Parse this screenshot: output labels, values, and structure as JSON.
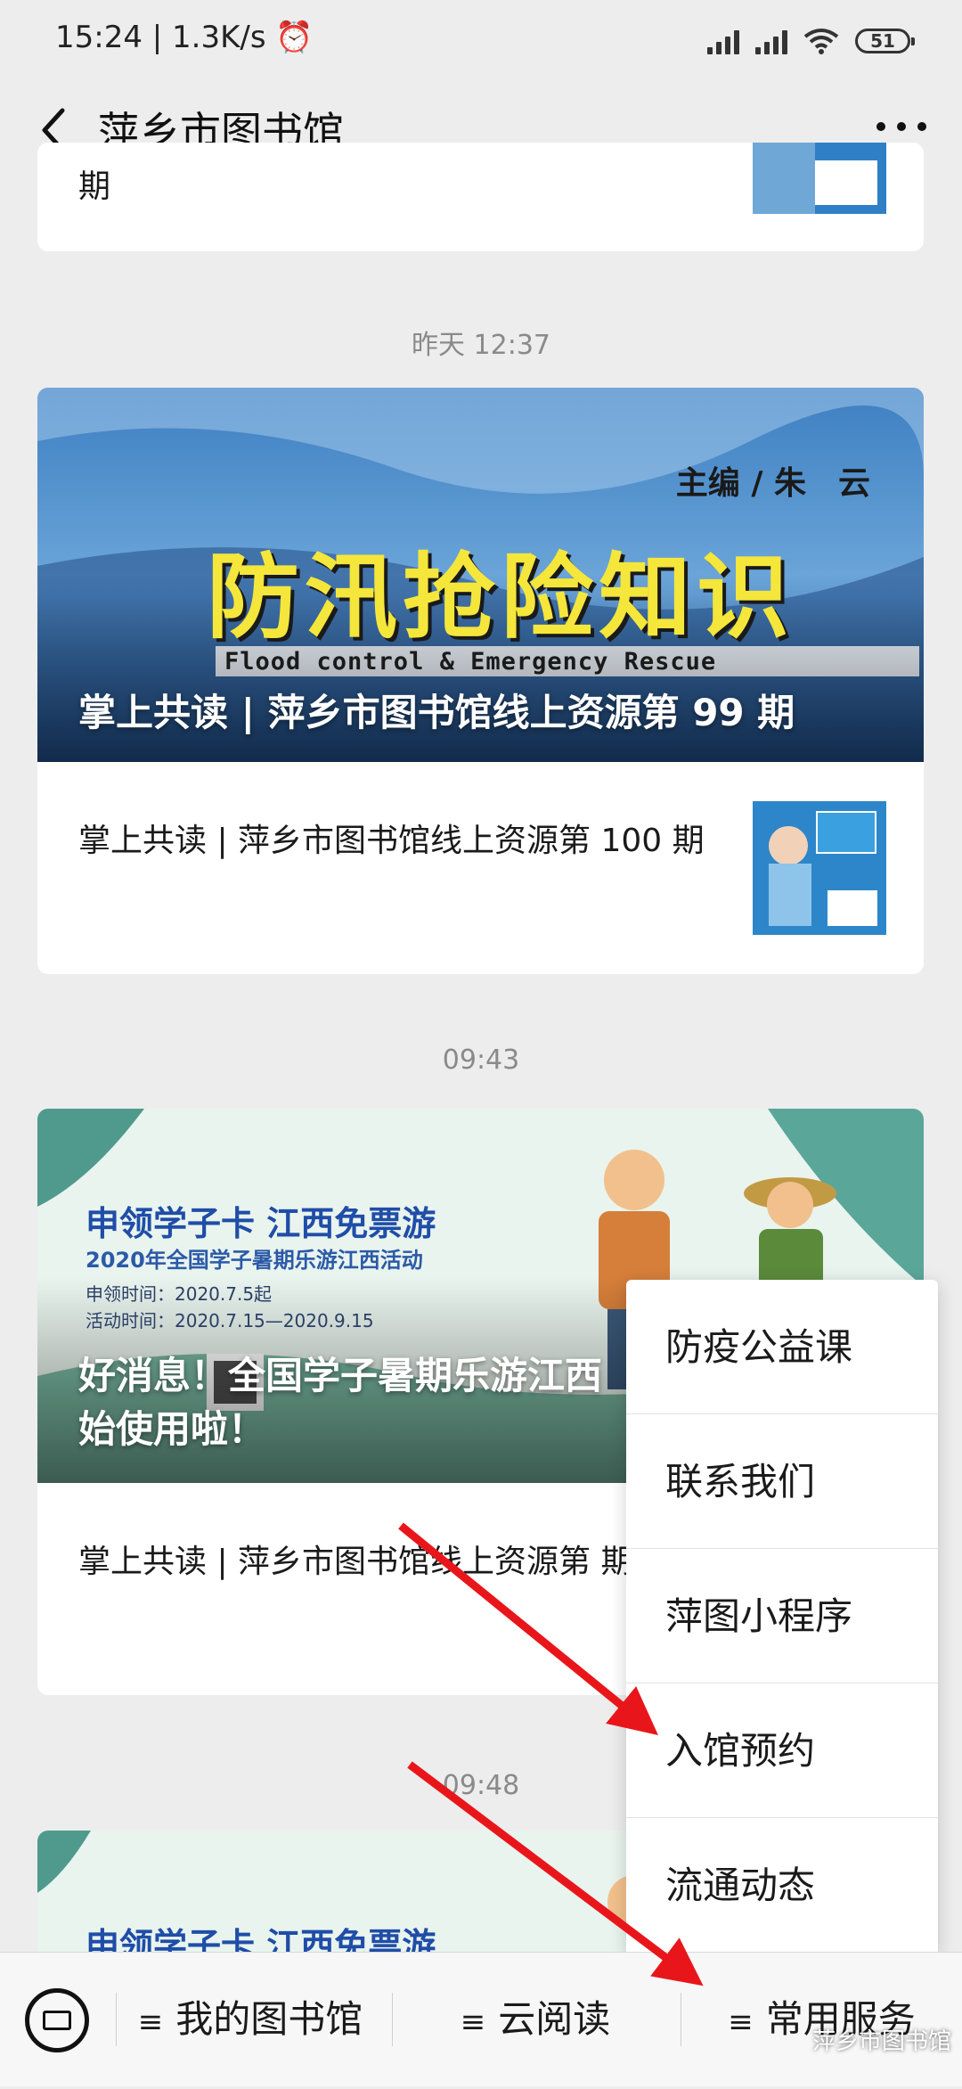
{
  "status_bar": {
    "time": "15:24 | 1.3K/s ⏰",
    "battery": "51"
  },
  "header": {
    "title": "萍乡市图书馆"
  },
  "top_card": {
    "partial_text": "期"
  },
  "group1": {
    "timestamp": "昨天 12:37",
    "banner_editor": "主编 / 朱　云",
    "banner_big": "防汛抢险知识",
    "banner_english": "Flood control & Emergency Rescue",
    "banner_title": "掌上共读 | 萍乡市图书馆线上资源第 99 期",
    "item_title": "掌上共读 | 萍乡市图书馆线上资源第 100 期"
  },
  "group2": {
    "timestamp": "09:43",
    "banner_line1": "申领学子卡 江西免票游",
    "banner_line2": "2020年全国学子暑期乐游江西活动",
    "banner_line3": "申领时间：2020.7.5起",
    "banner_line4": "活动时间：2020.7.15—2020.9.15",
    "banner_title": "好消息！全国学子暑期乐游江西 始使用啦！",
    "item_title": "掌上共读 | 萍乡市图书馆线上资源第 期"
  },
  "group3": {
    "timestamp": "09:48",
    "banner_line1": "申领学子卡 江西免票游"
  },
  "popup_menu": {
    "items": [
      "防疫公益课",
      "联系我们",
      "萍图小程序",
      "入馆预约",
      "流通动态"
    ]
  },
  "bottom_bar": {
    "tabs": [
      "我的图书馆",
      "云阅读",
      "常用服务"
    ],
    "menu_glyph": "≡"
  },
  "watermark": "萍乡市图书馆",
  "colors": {
    "accent_arrow": "#e8161b",
    "background": "#ededed"
  }
}
